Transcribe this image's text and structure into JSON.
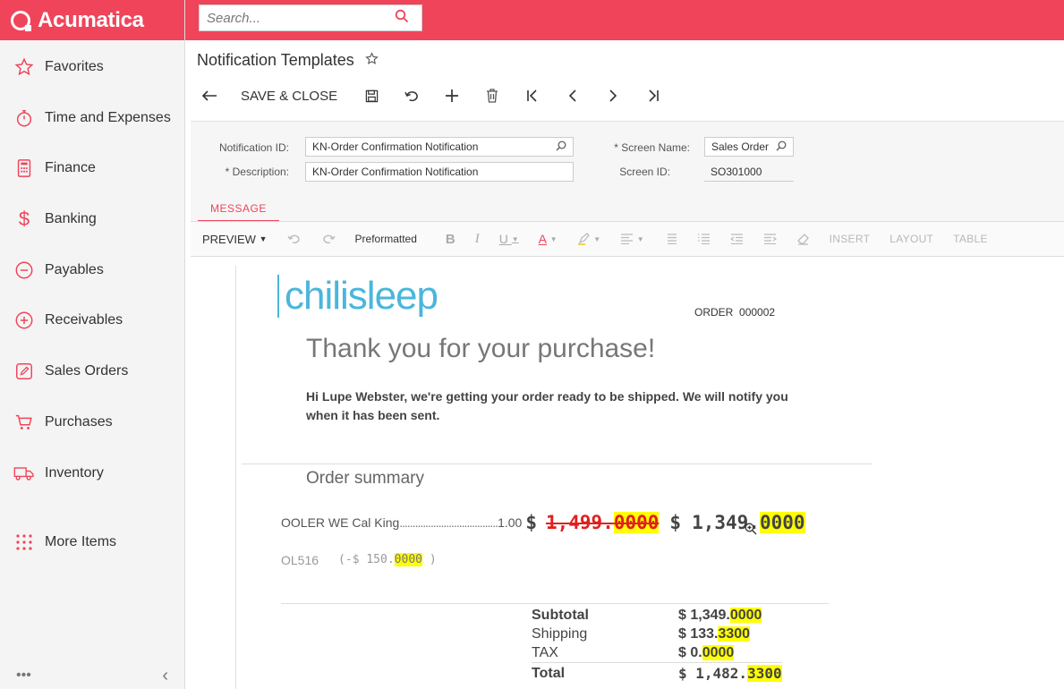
{
  "app": {
    "brand": "Acumatica"
  },
  "sidebar": {
    "items": [
      {
        "label": "Favorites",
        "icon": "star-icon"
      },
      {
        "label": "Time and Expenses",
        "icon": "stopwatch-icon"
      },
      {
        "label": "Finance",
        "icon": "calculator-icon"
      },
      {
        "label": "Banking",
        "icon": "dollar-icon"
      },
      {
        "label": "Payables",
        "icon": "minus-circle-icon"
      },
      {
        "label": "Receivables",
        "icon": "plus-circle-icon"
      },
      {
        "label": "Sales Orders",
        "icon": "pencil-icon"
      },
      {
        "label": "Purchases",
        "icon": "cart-icon"
      },
      {
        "label": "Inventory",
        "icon": "truck-icon"
      },
      {
        "label": "More Items",
        "icon": "grid-dots-icon"
      }
    ],
    "footer": {
      "more": "•••",
      "collapse": "‹"
    }
  },
  "search": {
    "placeholder": "Search..."
  },
  "page": {
    "title": "Notification Templates"
  },
  "toolbar": {
    "save_close": "SAVE & CLOSE"
  },
  "form": {
    "notification_id_label": "Notification ID:",
    "notification_id_value": "KN-Order Confirmation Notification",
    "description_label": "Description:",
    "description_value": "KN-Order Confirmation Notification",
    "screen_name_label": "Screen Name:",
    "screen_name_value": "Sales Order",
    "screen_id_label": "Screen ID:",
    "screen_id_value": "SO301000",
    "required_mark": "*"
  },
  "tabs": [
    {
      "label": "MESSAGE"
    }
  ],
  "editor_toolbar": {
    "preview": "PREVIEW",
    "format": "Preformatted",
    "bold": "B",
    "italic": "I",
    "underline": "U",
    "font_color": "A",
    "insert": "INSERT",
    "layout": "LAYOUT",
    "table": "TABLE"
  },
  "email": {
    "brand": "chilisleep",
    "order_label": "ORDER",
    "order_number": "000002",
    "thanks": "Thank you for your purchase!",
    "greeting": "Hi Lupe Webster, we're getting your order ready to be shipped. We will notify you when it has been sent.",
    "summary_title": "Order summary",
    "item": {
      "name": "OOLER WE Cal King",
      "dots": "......................................",
      "qty": "1.00",
      "currency": "$",
      "old_price_int": "1,499.",
      "old_price_dec": "0000",
      "new_price_int": "1,349.",
      "new_price_dec": "0000"
    },
    "discount": {
      "code": "OL516",
      "prefix": "(-$ 150.",
      "dec": "0000",
      "suffix": ")"
    },
    "totals": {
      "subtotal_label": "Subtotal",
      "subtotal_int": "$ 1,349.",
      "subtotal_dec": "0000",
      "shipping_label": "Shipping",
      "shipping_int": "$ 133.",
      "shipping_dec": "3300",
      "tax_label": "TAX",
      "tax_int": "$ 0.",
      "tax_dec": "0000",
      "total_label": "Total",
      "total_int": "$ 1,482.",
      "total_dec": "3300"
    }
  },
  "colors": {
    "accent": "#f0445a",
    "brand_blue": "#4ab6dc",
    "highlight": "#ffff00",
    "strike_red": "#e02020"
  }
}
